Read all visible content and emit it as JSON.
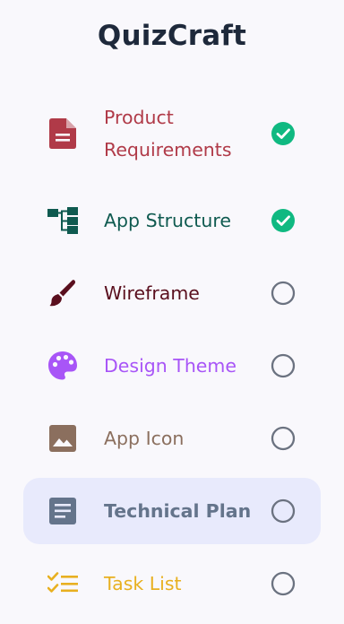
{
  "app": {
    "title": "QuizCraft"
  },
  "steps": [
    {
      "label": "Product\nRequirements",
      "icon": "document-icon",
      "color": "#b03a48",
      "status": "complete"
    },
    {
      "label": "App Structure",
      "icon": "sitemap-icon",
      "color": "#0f5a50",
      "status": "complete"
    },
    {
      "label": "Wireframe",
      "icon": "paintbrush-icon",
      "color": "#5a0f1e",
      "status": "incomplete"
    },
    {
      "label": "Design Theme",
      "icon": "palette-icon",
      "color": "#a855f7",
      "status": "incomplete"
    },
    {
      "label": "App Icon",
      "icon": "image-icon",
      "color": "#8b6f5e",
      "status": "incomplete"
    },
    {
      "label": "Technical Plan",
      "icon": "article-icon",
      "color": "#64748b",
      "status": "incomplete",
      "active": true
    },
    {
      "label": "Task List",
      "icon": "checklist-icon",
      "color": "#e8b020",
      "status": "incomplete"
    }
  ],
  "colors": {
    "complete": "#10b981",
    "incomplete": "#6b7280",
    "active_background": "#e8eafc"
  }
}
